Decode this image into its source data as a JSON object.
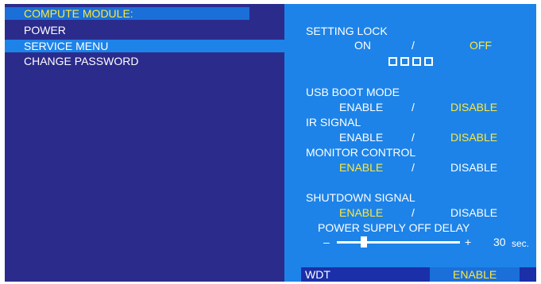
{
  "menu": {
    "header": "COMPUTE MODULE:",
    "items": [
      "POWER",
      "SERVICE MENU",
      "CHANGE PASSWORD"
    ]
  },
  "panel": {
    "setting_lock": {
      "label": "SETTING LOCK",
      "on": "ON",
      "sep": "/",
      "off": "OFF"
    },
    "usb_boot": {
      "label": "USB BOOT MODE",
      "enable": "ENABLE",
      "sep": "/",
      "disable": "DISABLE"
    },
    "ir_signal": {
      "label": "IR SIGNAL",
      "enable": "ENABLE",
      "sep": "/",
      "disable": "DISABLE"
    },
    "monitor_control": {
      "label": "MONITOR CONTROL",
      "enable": "ENABLE",
      "sep": "/",
      "disable": "DISABLE"
    },
    "shutdown_signal": {
      "label": "SHUTDOWN SIGNAL",
      "enable": "ENABLE",
      "sep": "/",
      "disable": "DISABLE"
    },
    "power_supply": {
      "label": "POWER SUPPLY OFF DELAY",
      "minus": "–",
      "plus": "+",
      "value": "30",
      "unit": "sec.",
      "level": 0.22
    },
    "wdt": {
      "label": "WDT",
      "value": "ENABLE"
    }
  },
  "colors": {
    "left_bg": "#2b2b8c",
    "right_bg": "#1d83e8",
    "highlight": "#ffe83a"
  }
}
